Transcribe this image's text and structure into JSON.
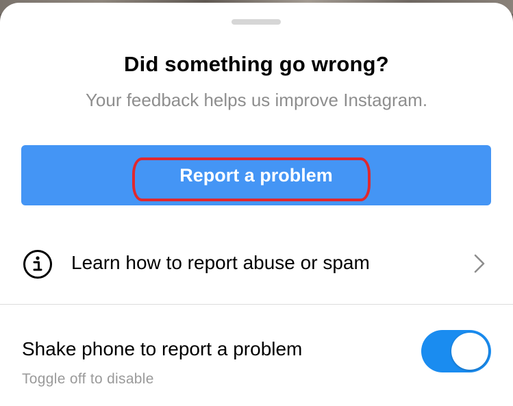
{
  "sheet": {
    "title": "Did something go wrong?",
    "subtitle": "Your feedback helps us improve Instagram."
  },
  "primary_action": {
    "label": "Report a problem",
    "color": "#4495f5",
    "highlight_color": "#e0282e"
  },
  "learn_row": {
    "icon": "info-icon",
    "label": "Learn how to report abuse or spam",
    "trailing_icon": "chevron-right-icon"
  },
  "shake_setting": {
    "label": "Shake phone to report a problem",
    "sublabel": "Toggle off to disable",
    "enabled": true,
    "toggle_color": "#1a8cf0"
  }
}
